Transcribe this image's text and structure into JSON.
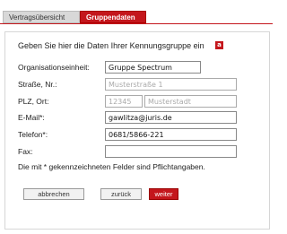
{
  "tabs": [
    {
      "label": "Vertragsübersicht"
    },
    {
      "label": "Gruppendaten"
    }
  ],
  "form": {
    "heading": "Geben Sie hier die Daten Ihrer Kennungsgruppe ein",
    "org_label": "Organisationseinheit:",
    "org_value": "Gruppe Spectrum",
    "street_label": "Straße, Nr.:",
    "street_value": "Musterstraße 1",
    "zip_label": "PLZ, Ort:",
    "zip_value": "12345",
    "city_value": "Musterstadt",
    "email_label": "E-Mail*:",
    "email_value": "gawlitza@juris.de",
    "phone_label": "Telefon*:",
    "phone_value": "0681/5866-221",
    "fax_label": "Fax:",
    "fax_value": "",
    "note": "Die mit * gekennzeichneten Felder sind Pflichtangaben."
  },
  "buttons": {
    "cancel": "abbrechen",
    "back": "zurück",
    "next": "weiter"
  }
}
